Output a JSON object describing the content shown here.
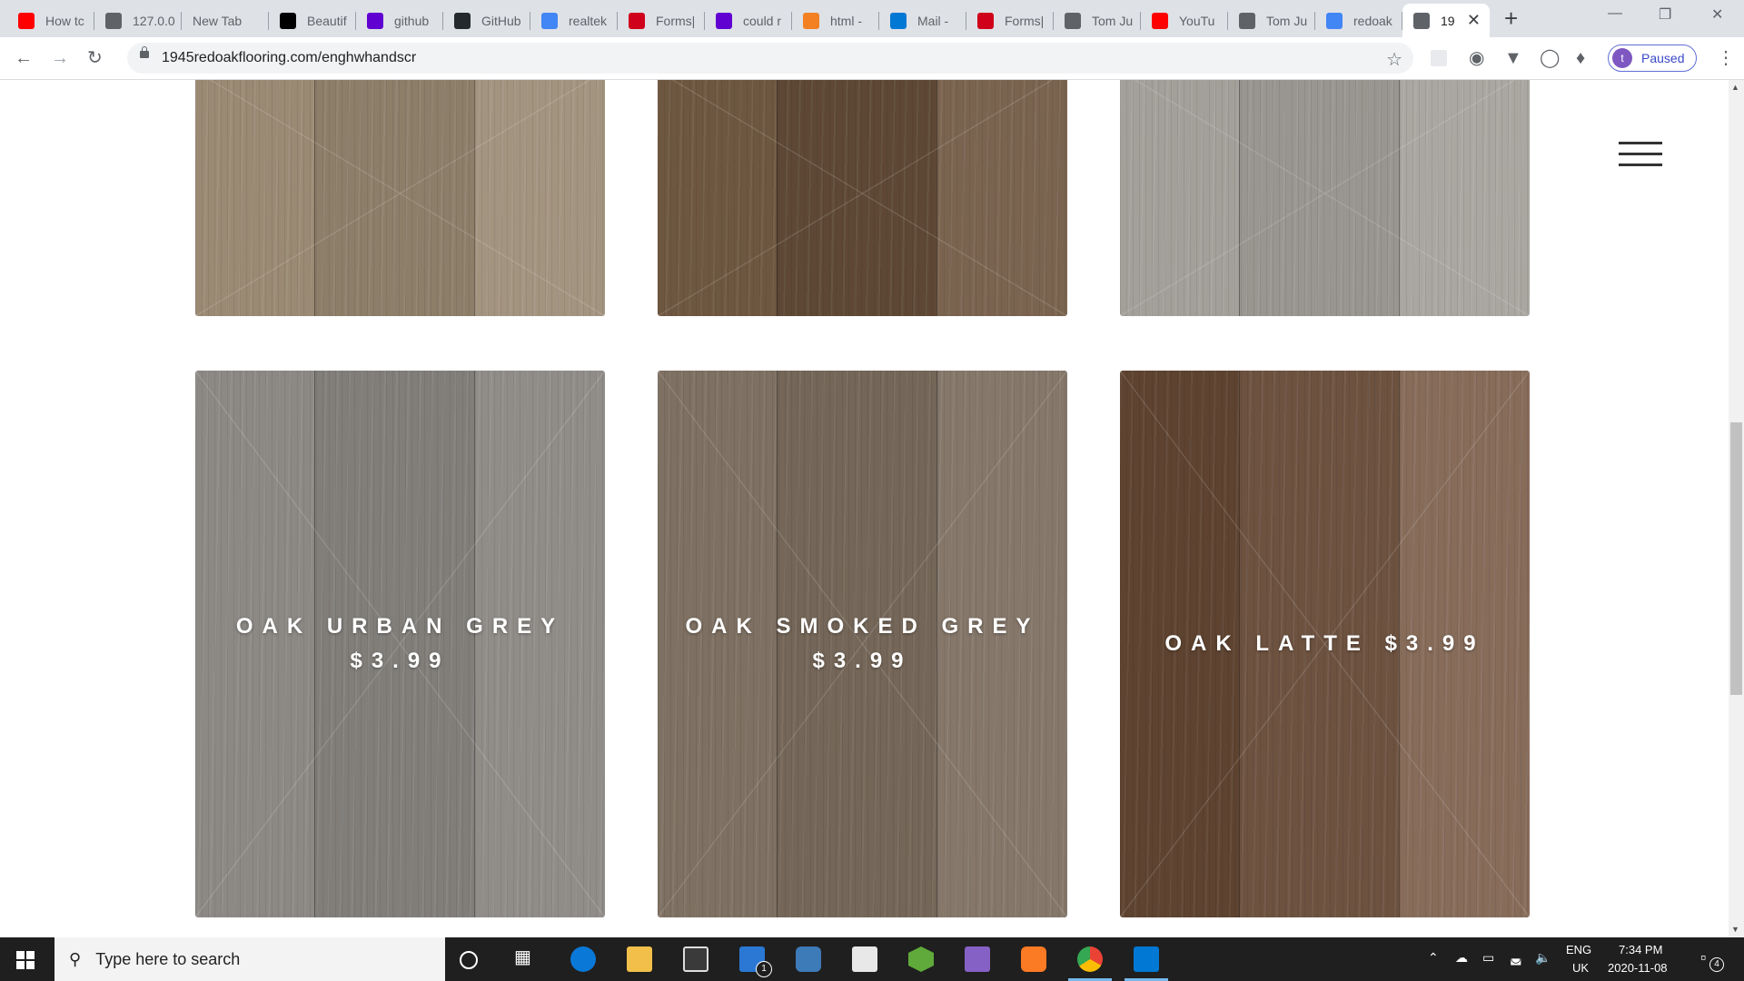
{
  "browser": {
    "tabs": [
      {
        "title": "How tc",
        "favicon_color": "#ff0000",
        "favicon": "youtube-icon"
      },
      {
        "title": "127.0.0",
        "favicon_color": "#5f6368",
        "favicon": "globe-icon"
      },
      {
        "title": "New Tab",
        "favicon_color": "",
        "favicon": ""
      },
      {
        "title": "Beautif",
        "favicon_color": "#000000",
        "favicon": "beautiful-icon"
      },
      {
        "title": "github",
        "favicon_color": "#6001d2",
        "favicon": "yahoo-icon"
      },
      {
        "title": "GitHub",
        "favicon_color": "#24292e",
        "favicon": "github-icon"
      },
      {
        "title": "realtek",
        "favicon_color": "#4285f4",
        "favicon": "google-icon"
      },
      {
        "title": "Forms|",
        "favicon_color": "#d0021b",
        "favicon": "formspree-icon"
      },
      {
        "title": "could r",
        "favicon_color": "#6001d2",
        "favicon": "yahoo-icon"
      },
      {
        "title": "html -",
        "favicon_color": "#f48024",
        "favicon": "stackoverflow-icon"
      },
      {
        "title": "Mail -",
        "favicon_color": "#0078d4",
        "favicon": "outlook-icon"
      },
      {
        "title": "Forms|",
        "favicon_color": "#d0021b",
        "favicon": "formspree-icon"
      },
      {
        "title": "Tom Ju",
        "favicon_color": "#5f6368",
        "favicon": "globe-icon"
      },
      {
        "title": "YouTu",
        "favicon_color": "#ff0000",
        "favicon": "youtube-icon"
      },
      {
        "title": "Tom Ju",
        "favicon_color": "#5f6368",
        "favicon": "globe-icon"
      },
      {
        "title": "redoak",
        "favicon_color": "#4285f4",
        "favicon": "google-icon"
      },
      {
        "title": "19",
        "favicon_color": "#5f6368",
        "favicon": "globe-icon"
      }
    ],
    "url": "1945redoakflooring.com/enghwhandscr",
    "profile_label": "Paused",
    "profile_initial": "t"
  },
  "page": {
    "products_top": [
      {
        "name": "",
        "colors": [
          "#9a8a74",
          "#8d7e69",
          "#a39480"
        ]
      },
      {
        "name": "",
        "colors": [
          "#6e5741",
          "#5e4835",
          "#7a6450"
        ]
      },
      {
        "name": "",
        "colors": [
          "#a3a09a",
          "#99958f",
          "#aaa7a1"
        ]
      }
    ],
    "products": [
      {
        "line1": "OAK URBAN GREY",
        "line2": "$3.99",
        "colors": [
          "#8c8985",
          "#817e7a",
          "#908d89"
        ]
      },
      {
        "line1": "OAK SMOKED GREY",
        "line2": "$3.99",
        "colors": [
          "#7e7062",
          "#746658",
          "#85776a"
        ]
      },
      {
        "line1": "OAK LATTE $3.99",
        "line2": "",
        "colors": [
          "#5e4330",
          "#6d5240",
          "#876c5a"
        ]
      }
    ]
  },
  "taskbar": {
    "search_placeholder": "Type here to search",
    "language": "ENG",
    "region": "UK",
    "time": "7:34 PM",
    "date": "2020-11-08",
    "notification_count": "4",
    "mail_badge": "1"
  }
}
